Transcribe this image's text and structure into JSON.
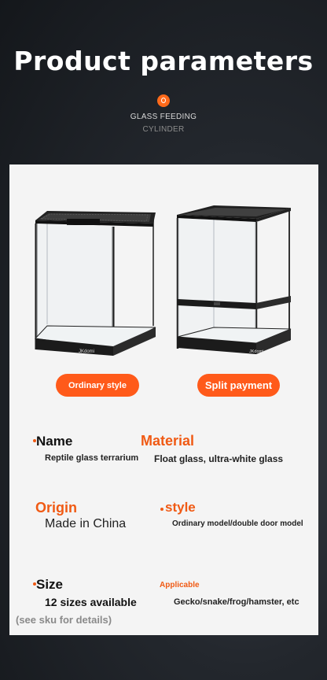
{
  "header": {
    "title": "Product parameters",
    "subtitle_line1": "GLASS FEEDING",
    "subtitle_line2": "CYLINDER"
  },
  "buttons": {
    "left_label": "Ordinary style",
    "right_label": "Split payment"
  },
  "specs": {
    "name_label": "Name",
    "name_value": "Reptile glass terrarium",
    "material_label": "Material",
    "material_value": "Float glass, ultra-white glass",
    "origin_label": "Origin",
    "origin_value": "Made in China",
    "style_label": "style",
    "style_value": "Ordinary model/double door model",
    "size_label": "Size",
    "size_value": "12 sizes available",
    "size_note": "(see sku for details)",
    "applicable_label": "Applicable",
    "applicable_value": "Gecko/snake/frog/hamster, etc"
  },
  "images": {
    "left_brand": "JKdomi",
    "right_brand": "JKdomi"
  },
  "colors": {
    "accent": "#ff5a1a",
    "card_bg": "#f4f4f4"
  }
}
